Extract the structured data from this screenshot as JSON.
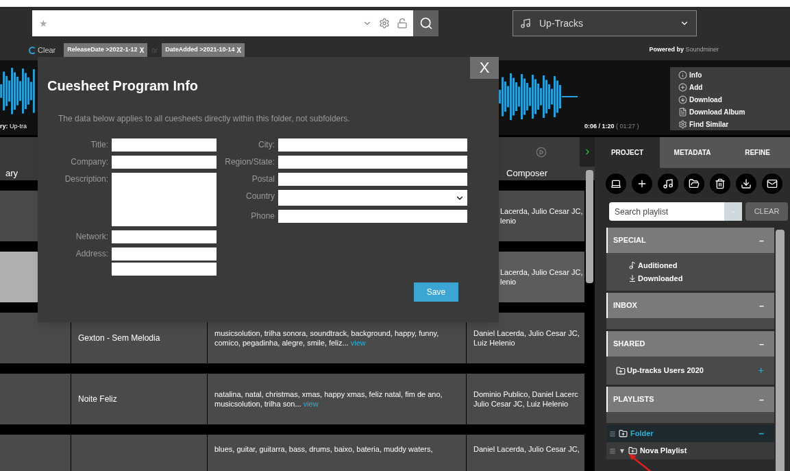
{
  "search": {
    "star": "★"
  },
  "library_select": {
    "value": "Up-Tracks"
  },
  "filters": {
    "clear": "Clear",
    "joiner": "or",
    "chips": [
      {
        "label": "ReleaseDate >2022-1-12",
        "remove": "X"
      },
      {
        "label": "DateAdded >2021-10-14",
        "remove": "X"
      }
    ]
  },
  "powered_by": {
    "prefix": "Powered by",
    "brand": "Soundminer"
  },
  "player": {
    "library_prefix": "ry:",
    "library": "Up-tra",
    "time": "0:06 / 1:20",
    "duration": "( 01:27 )",
    "actions": [
      {
        "kind": "info",
        "label": "Info"
      },
      {
        "kind": "add",
        "label": "Add"
      },
      {
        "kind": "download",
        "label": "Download"
      },
      {
        "kind": "album",
        "label": "Download Album"
      },
      {
        "kind": "similar",
        "label": "Find Similar"
      }
    ]
  },
  "results": {
    "column_1_header": "ary",
    "composer_header": "Composer",
    "rows": [
      {
        "selected": false,
        "composer": [
          "Lacerda, Julio Cesar JC,",
          "lenio"
        ]
      },
      {
        "selected": true,
        "composer": [
          "Lacerda, Julio Cesar JC,",
          "lenio"
        ]
      },
      {
        "selected": false,
        "title": "Gexton - Sem Melodia",
        "keywords": "musicsolution, trilha sonora, soundtrack, background, happy, funny, comico, pegadinha, alegre, smile, feliz...",
        "view": "view",
        "composer": [
          "Daniel Lacerda, Julio Cesar JC,",
          "Luiz Helenio"
        ]
      },
      {
        "selected": false,
        "title": "Noite Feliz",
        "keywords": "natalina, natal, christmas, xmas, happy xmas, feliz natal, fim de ano, musicsolution, trilha son...",
        "view": "view",
        "composer": [
          "Dominio Publico, Daniel Lacerc",
          "Julio Cesar JC, Luiz Helenio"
        ]
      },
      {
        "selected": false,
        "keywords": "blues, guitar, guitarra, bass, drums, baixo, bateria, muddy waters,",
        "composer": [
          "Daniel Lacerda, Julio Cesar JC,"
        ]
      }
    ]
  },
  "dialog": {
    "title": "Cuesheet Program Info",
    "close": "X",
    "note": "The data below applies to all cuesheets directly within this folder, not subfolders.",
    "left_fields": [
      {
        "kind": "text",
        "label": "Title:"
      },
      {
        "kind": "text",
        "label": "Company:"
      },
      {
        "kind": "textarea",
        "label": "Description:"
      },
      {
        "kind": "text",
        "label": "Network:"
      },
      {
        "kind": "double",
        "label": "Address:"
      }
    ],
    "right_fields": [
      {
        "kind": "text",
        "label": "City:"
      },
      {
        "kind": "text",
        "label": "Region/State:"
      },
      {
        "kind": "text",
        "label": "Postal"
      },
      {
        "kind": "select",
        "label": "Country"
      },
      {
        "kind": "text",
        "label": "Phone"
      }
    ],
    "save": "Save"
  },
  "panel": {
    "tabs": [
      {
        "label": "PROJECT",
        "selected": true
      },
      {
        "label": "METADATA",
        "selected": false
      },
      {
        "label": "REFINE",
        "selected": false
      }
    ],
    "search": {
      "placeholder": "Search playlist"
    },
    "clear": "CLEAR",
    "sections": [
      {
        "title": "SPECIAL",
        "toggle": "–",
        "items": [
          {
            "kind": "auditioned",
            "label": "Auditioned"
          },
          {
            "kind": "downloaded",
            "label": "Downloaded"
          }
        ]
      },
      {
        "title": "INBOX",
        "toggle": "–"
      },
      {
        "title": "SHARED",
        "toggle": "–",
        "items": [
          {
            "kind": "shared",
            "label": "Up-tracks Users 2020",
            "add": "+"
          }
        ]
      },
      {
        "title": "PLAYLISTS",
        "toggle": "–"
      }
    ],
    "playlists": [
      {
        "label": "Folder",
        "selected": true,
        "toggle": "–",
        "children": [
          {
            "label": "Nova Playlist",
            "selected": false,
            "caret": "▼"
          }
        ]
      }
    ]
  }
}
